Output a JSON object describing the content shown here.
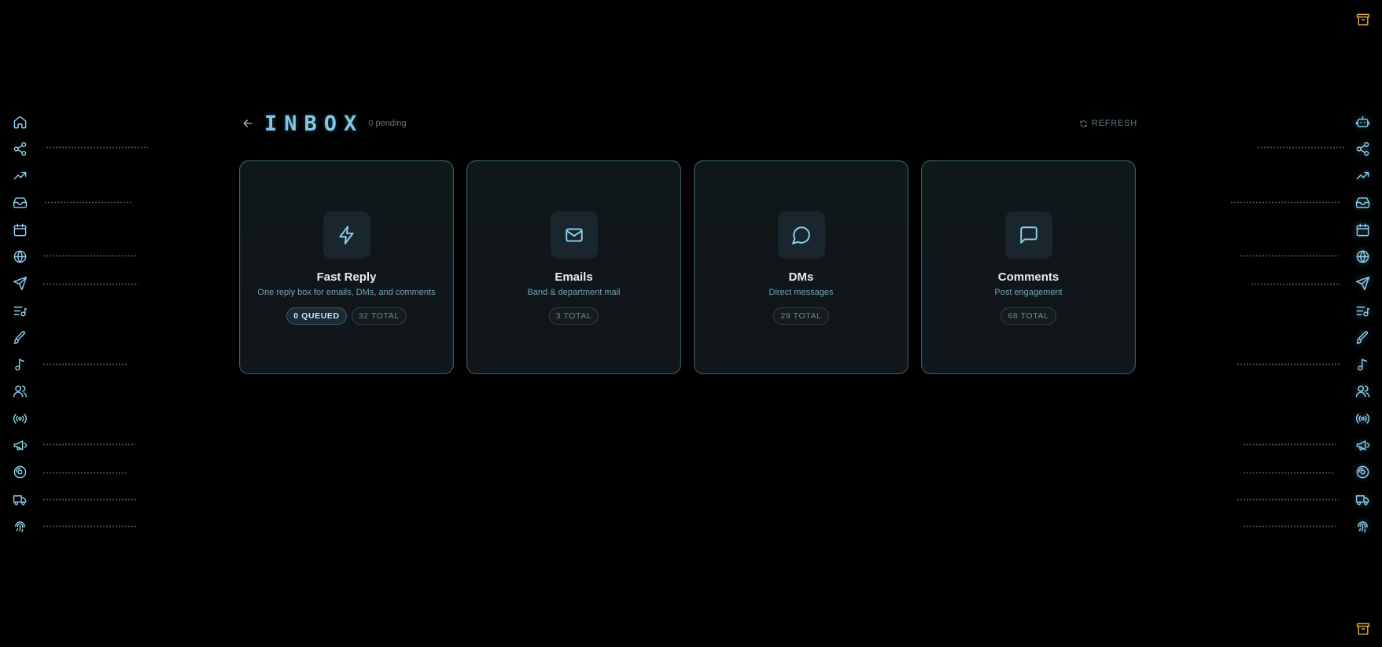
{
  "header": {
    "title": "INBOX",
    "pending": "0 pending",
    "refresh_label": "REFRESH"
  },
  "cards": [
    {
      "name": "fast-reply",
      "icon": "lightning-icon",
      "title": "Fast Reply",
      "subtitle": "One reply box for emails, DMs, and comments",
      "badges": [
        "0 QUEUED",
        "32 TOTAL"
      ]
    },
    {
      "name": "emails",
      "icon": "mail-icon",
      "title": "Emails",
      "subtitle": "Band & department mail",
      "badges": [
        "3 TOTAL"
      ]
    },
    {
      "name": "dms",
      "icon": "chat-bubble-icon",
      "title": "DMs",
      "subtitle": "Direct messages",
      "badges": [
        "29 TOTAL"
      ]
    },
    {
      "name": "comments",
      "icon": "comment-icon",
      "title": "Comments",
      "subtitle": "Post engagement",
      "badges": [
        "68 TOTAL"
      ]
    }
  ],
  "left_nav_icons": [
    "home-icon",
    "share-icon",
    "trending-icon",
    "inbox-icon",
    "calendar-icon",
    "globe-icon",
    "send-icon",
    "list-music-icon",
    "brush-icon",
    "music-note-icon",
    "users-icon",
    "broadcast-icon",
    "megaphone-icon",
    "disc-icon",
    "truck-icon",
    "fingerprint-icon"
  ],
  "right_nav_icons": [
    "bot-icon",
    "share-icon",
    "trending-icon",
    "inbox-icon",
    "calendar-icon",
    "globe-icon",
    "send-icon",
    "list-music-icon",
    "brush-icon",
    "music-note-icon",
    "users-icon",
    "broadcast-icon",
    "megaphone-icon",
    "disc-icon",
    "truck-icon",
    "fingerprint-icon"
  ],
  "corner_icons": [
    "archive-icon"
  ],
  "colors": {
    "accent": "#8fd0ee",
    "corner": "#e0a84a",
    "background": "#000000",
    "card": "#11161a"
  }
}
